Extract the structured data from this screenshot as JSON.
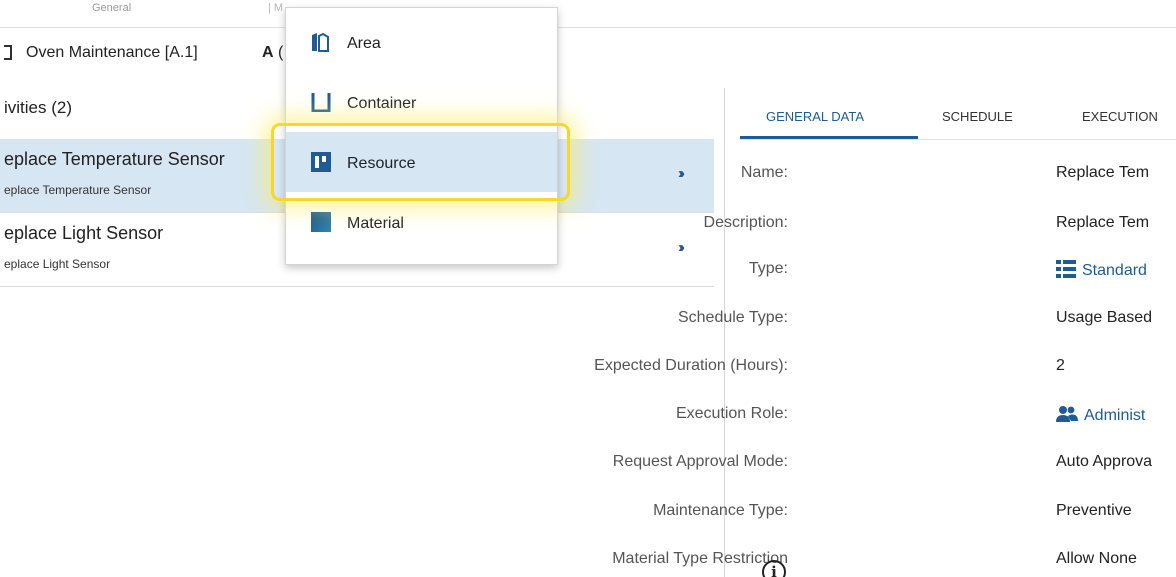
{
  "topbar": {
    "crumb_general": "General",
    "crumb_next": "| M"
  },
  "object": {
    "title": "Oven Maintenance [A.1]",
    "letter": "A",
    "suffix": "("
  },
  "activities": {
    "header": "ivities (2)",
    "items": [
      {
        "title": "eplace Temperature Sensor",
        "subtitle": "eplace Temperature Sensor",
        "selected": true
      },
      {
        "title": "eplace Light Sensor",
        "subtitle": "eplace Light Sensor",
        "selected": false
      }
    ],
    "chevron": "›››"
  },
  "tabs": [
    {
      "label": "GENERAL DATA",
      "active": true
    },
    {
      "label": "SCHEDULE",
      "active": false
    },
    {
      "label": "EXECUTION",
      "active": false
    }
  ],
  "properties": [
    {
      "label": "Name:",
      "value": "Replace Tem"
    },
    {
      "label": "Description:",
      "value": "Replace Tem"
    },
    {
      "label": "Type:",
      "value": "Standard",
      "icon": "list-icon",
      "link": true
    },
    {
      "label": "Schedule Type:",
      "value": "Usage Based"
    },
    {
      "label": "Expected Duration (Hours):",
      "value": "2"
    },
    {
      "label": "Execution Role:",
      "value": "Administ",
      "icon": "users-icon",
      "link": true
    },
    {
      "label": "Request Approval Mode:",
      "value": "Auto Approva"
    },
    {
      "label": "Maintenance Type:",
      "value": "Preventive"
    },
    {
      "label": "Material Type Restriction",
      "value": "Allow None"
    }
  ],
  "info_icon": "i",
  "dropdown": {
    "items": [
      {
        "label": "Area",
        "icon": "area-icon",
        "highlight": false
      },
      {
        "label": "Container",
        "icon": "container-icon",
        "highlight": false
      },
      {
        "label": "Resource",
        "icon": "resource-icon",
        "highlight": true
      },
      {
        "label": "Material",
        "icon": "material-icon",
        "highlight": false
      }
    ]
  },
  "colors": {
    "accent": "#1f5b94",
    "selection": "#d6e6f3",
    "focus_ring": "#f7d728"
  }
}
